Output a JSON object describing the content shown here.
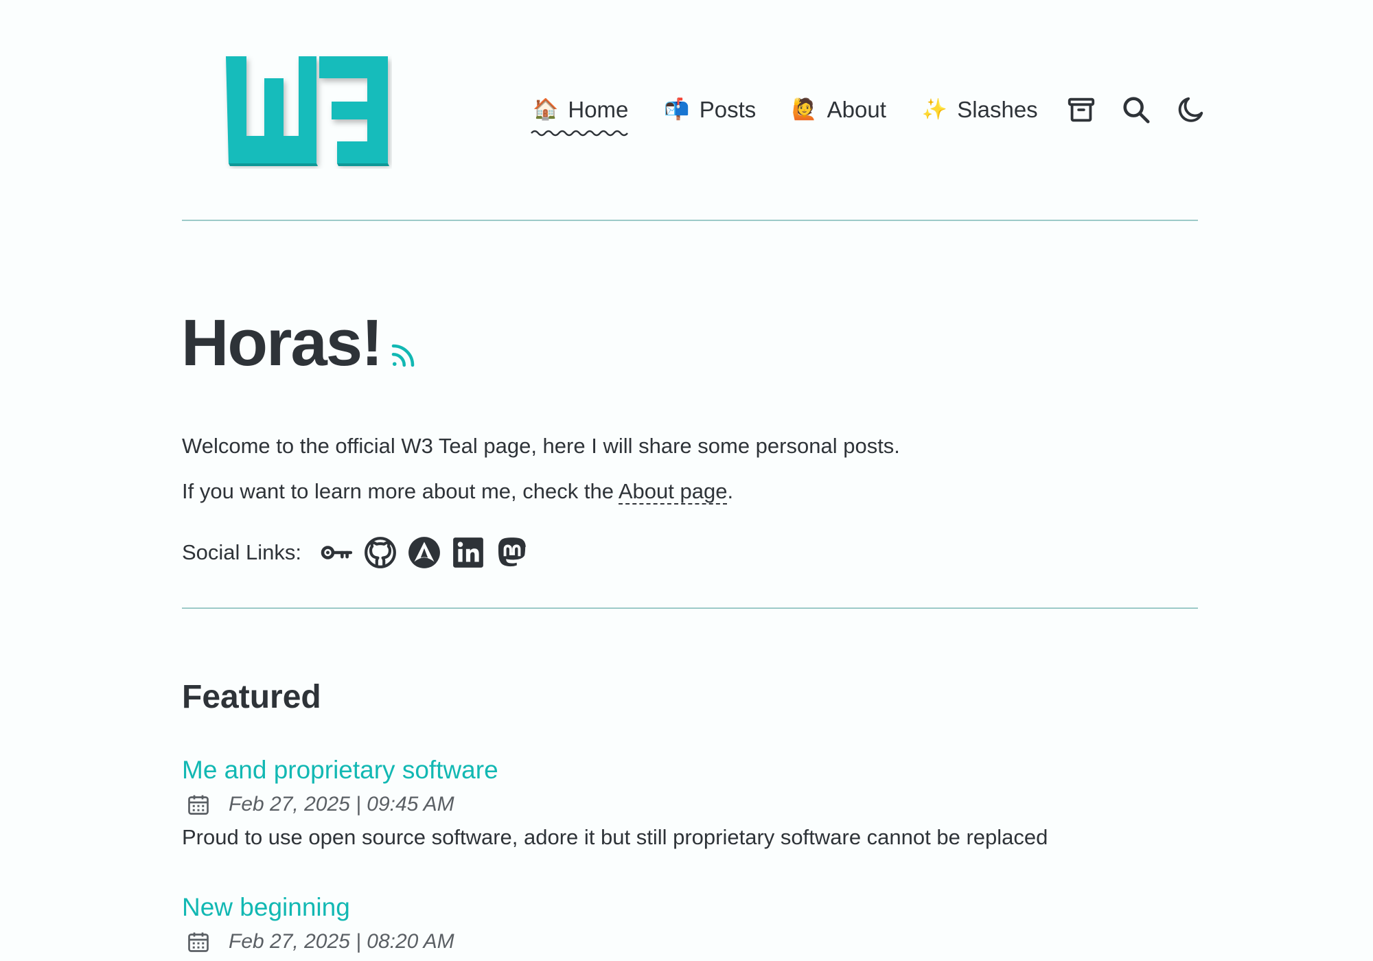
{
  "brand": {
    "logo_icon": "w3-logo",
    "accent_color": "#12b8b3"
  },
  "nav": {
    "items": [
      {
        "emoji": "🏠",
        "label": "Home",
        "active": true
      },
      {
        "emoji": "📬",
        "label": "Posts",
        "active": false
      },
      {
        "emoji": "🙋",
        "label": "About",
        "active": false
      },
      {
        "emoji": "✨",
        "label": "Slashes",
        "active": false
      }
    ],
    "icons": [
      "archive-icon",
      "search-icon",
      "moon-icon"
    ]
  },
  "hero": {
    "title": "Horas!",
    "rss_icon": "rss-icon",
    "intro_1": "Welcome to the official W3 Teal page, here I will share some personal posts.",
    "intro_2_prefix": "If you want to learn more about me, check the ",
    "intro_2_link": "About page",
    "intro_2_suffix": ".",
    "social_label": "Social Links:",
    "social_icons": [
      "key-icon",
      "github-icon",
      "arch-icon",
      "linkedin-icon",
      "mastodon-icon"
    ]
  },
  "featured": {
    "heading": "Featured",
    "posts": [
      {
        "title": "Me and proprietary software",
        "date": "Feb 27, 2025 | 09:45 AM",
        "description": "Proud to use open source software, adore it but still proprietary software cannot be replaced"
      },
      {
        "title": "New beginning",
        "date": "Feb 27, 2025 | 08:20 AM",
        "description": ""
      }
    ]
  }
}
